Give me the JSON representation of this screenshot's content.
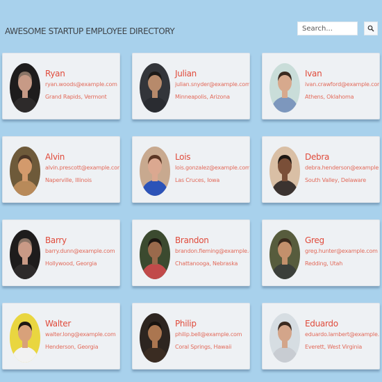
{
  "header": {
    "title": "AWESOME STARTUP EMPLOYEE DIRECTORY",
    "search_placeholder": "Search...",
    "search_icon": "magnifier-icon"
  },
  "colors": {
    "background": "#a8d1ec",
    "card": "#eef1f4",
    "name": "#e04a3a",
    "details": "#e26a5a",
    "title": "#3e4348"
  },
  "employees": [
    {
      "name": "Ryan",
      "email": "ryan.woods@example.com",
      "location": "Grand Rapids, Vermont",
      "avatar": {
        "bg": "#1e1c1c",
        "skin": "#c79a86",
        "hair": "#8a7466",
        "shirt": "#2d2a2a"
      }
    },
    {
      "name": "Julian",
      "email": "julian.snyder@example.com",
      "location": "Minneapolis, Arizona",
      "avatar": {
        "bg": "#33353a",
        "skin": "#b78a6b",
        "hair": "#1d1a18",
        "shirt": "#2a2c31"
      }
    },
    {
      "name": "Ivan",
      "email": "ivan.crawford@example.com",
      "location": "Athens, Oklahoma",
      "avatar": {
        "bg": "#c9ddd9",
        "skin": "#d7a98d",
        "hair": "#3a2a20",
        "shirt": "#7d97bd"
      }
    },
    {
      "name": "Alvin",
      "email": "alvin.prescott@example.com",
      "location": "Naperville, Illinois",
      "avatar": {
        "bg": "#6e5a3a",
        "skin": "#d39a6c",
        "hair": "#4a3526",
        "shirt": "#b88a5a"
      }
    },
    {
      "name": "Lois",
      "email": "lois.gonzalez@example.com",
      "location": "Las Cruces, Iowa",
      "avatar": {
        "bg": "#c8a98f",
        "skin": "#dba890",
        "hair": "#5a3624",
        "shirt": "#2c53b8"
      }
    },
    {
      "name": "Debra",
      "email": "debra.henderson@example.com",
      "location": "South Valley, Delaware",
      "avatar": {
        "bg": "#d9bfa5",
        "skin": "#7a4f38",
        "hair": "#1c1612",
        "shirt": "#3b3330"
      }
    },
    {
      "name": "Barry",
      "email": "barry.dunn@example.com",
      "location": "Hollywood, Georgia",
      "avatar": {
        "bg": "#1e1c1c",
        "skin": "#c99a86",
        "hair": "#8a7466",
        "shirt": "#2d2a2a"
      }
    },
    {
      "name": "Brandon",
      "email": "brandon.fleming@example.com",
      "location": "Chattanooga, Nebraska",
      "avatar": {
        "bg": "#3b4a2f",
        "skin": "#9a6a4c",
        "hair": "#1d1712",
        "shirt": "#c14a4a"
      }
    },
    {
      "name": "Greg",
      "email": "greg.hunter@example.com",
      "location": "Redding, Utah",
      "avatar": {
        "bg": "#575c3d",
        "skin": "#c3906c",
        "hair": "#3a2a1d",
        "shirt": "#3b3f3a"
      }
    },
    {
      "name": "Walter",
      "email": "walter.long@example.com",
      "location": "Henderson, Georgia",
      "avatar": {
        "bg": "#e9d640",
        "skin": "#d8a17a",
        "hair": "#1e1814",
        "shirt": "#f2f2f2"
      }
    },
    {
      "name": "Philip",
      "email": "philip.bell@example.com",
      "location": "Coral Springs, Hawaii",
      "avatar": {
        "bg": "#2d2520",
        "skin": "#ab7650",
        "hair": "#1a1410",
        "shirt": "#3a2c22"
      }
    },
    {
      "name": "Eduardo",
      "email": "eduardo.lambert@example.com",
      "location": "Everett, West Virginia",
      "avatar": {
        "bg": "#d6dde2",
        "skin": "#d3a58a",
        "hair": "#3a2a20",
        "shirt": "#c8ccd2"
      }
    }
  ]
}
